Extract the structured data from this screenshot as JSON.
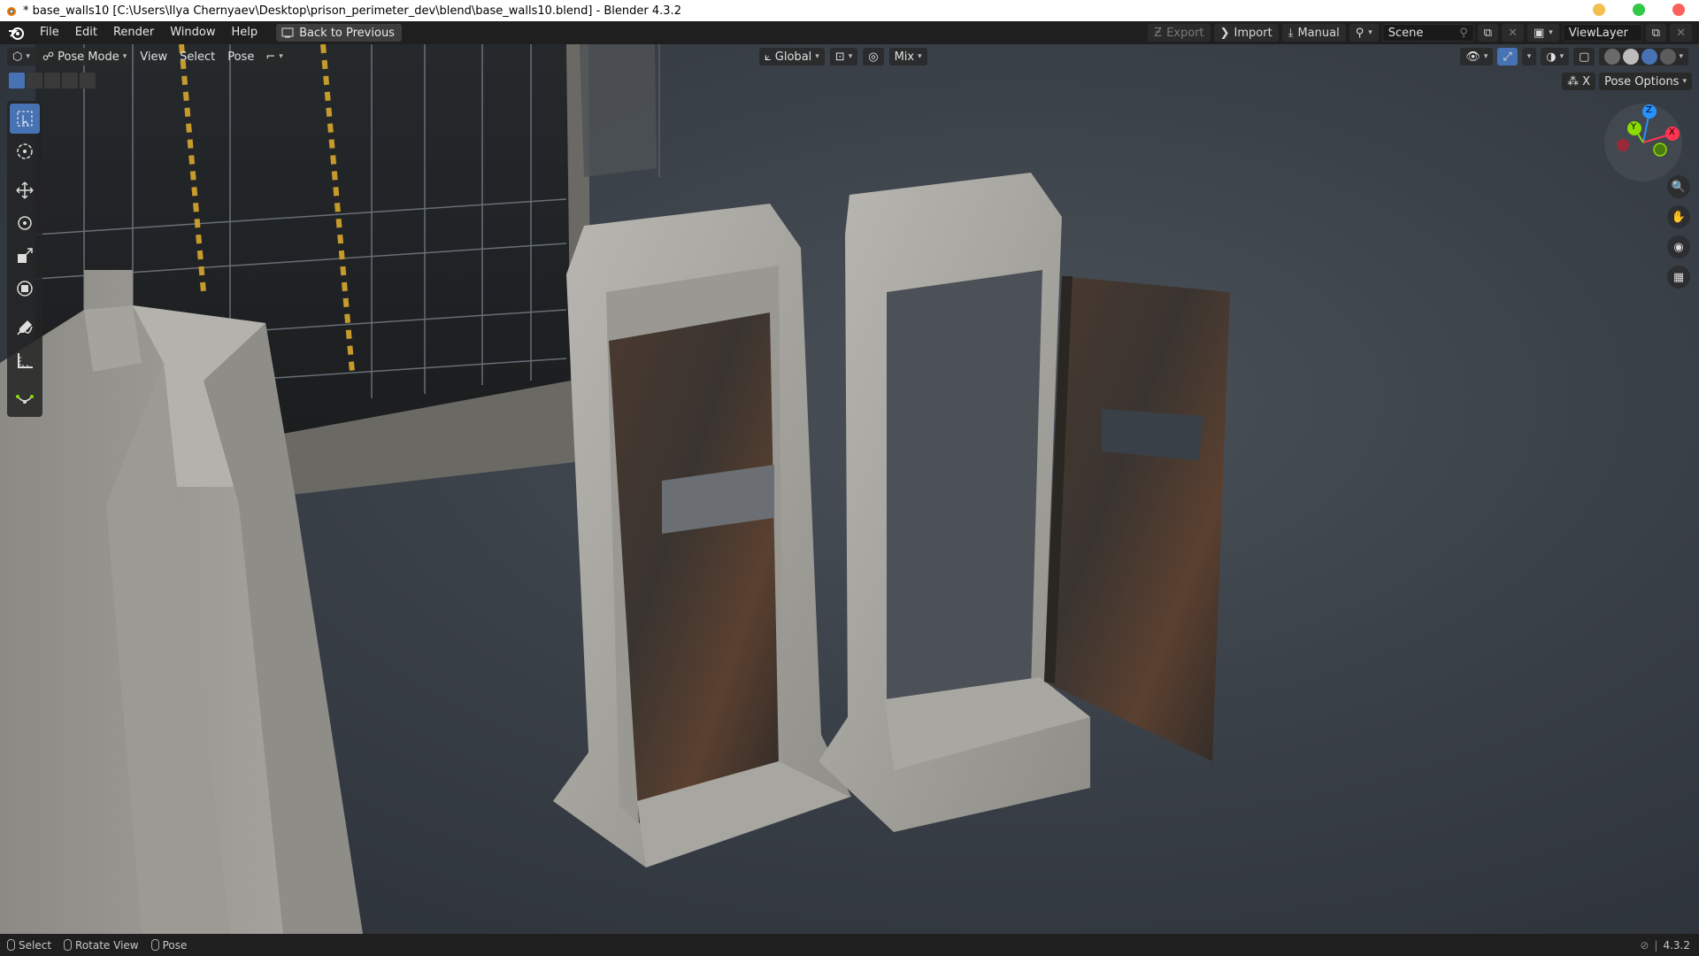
{
  "window": {
    "title": "* base_walls10 [C:\\Users\\Ilya Chernyaev\\Desktop\\prison_perimeter_dev\\blend\\base_walls10.blend] - Blender 4.3.2",
    "buttons": {
      "minimize_color": "#f4bf4f",
      "maximize_color": "#32c848",
      "close_color": "#fc605c"
    }
  },
  "menubar": {
    "items": [
      "File",
      "Edit",
      "Render",
      "Window",
      "Help"
    ],
    "back_label": "Back to Previous",
    "export_label": "Export",
    "import_label": "Import",
    "manual_label": "Manual",
    "scene_value": "Scene",
    "viewlayer_value": "ViewLayer"
  },
  "viewport_header": {
    "mode_label": "Pose Mode",
    "menus": [
      "View",
      "Select",
      "Pose"
    ],
    "orientation_label": "Global",
    "proportional_label": "Mix",
    "pose_options_label": "Pose Options",
    "x_label": "X"
  },
  "toolbar": {
    "tools": [
      "select-box",
      "cursor",
      "move",
      "rotate",
      "scale",
      "transform",
      "annotate",
      "measure",
      "relax-pose"
    ],
    "active": "select-box"
  },
  "gizmo": {
    "x_label": "X",
    "y_label": "Y",
    "z_label": "Z",
    "x_color": "#ff3352",
    "y_color": "#8bdc00",
    "z_color": "#2890ff"
  },
  "statusbar": {
    "items": [
      "Select",
      "Rotate View",
      "Pose"
    ],
    "version": "4.3.2"
  },
  "colors": {
    "accent": "#4772b3",
    "header_bg": "#1f1f1f",
    "viewport_bg": "#3a4048"
  }
}
